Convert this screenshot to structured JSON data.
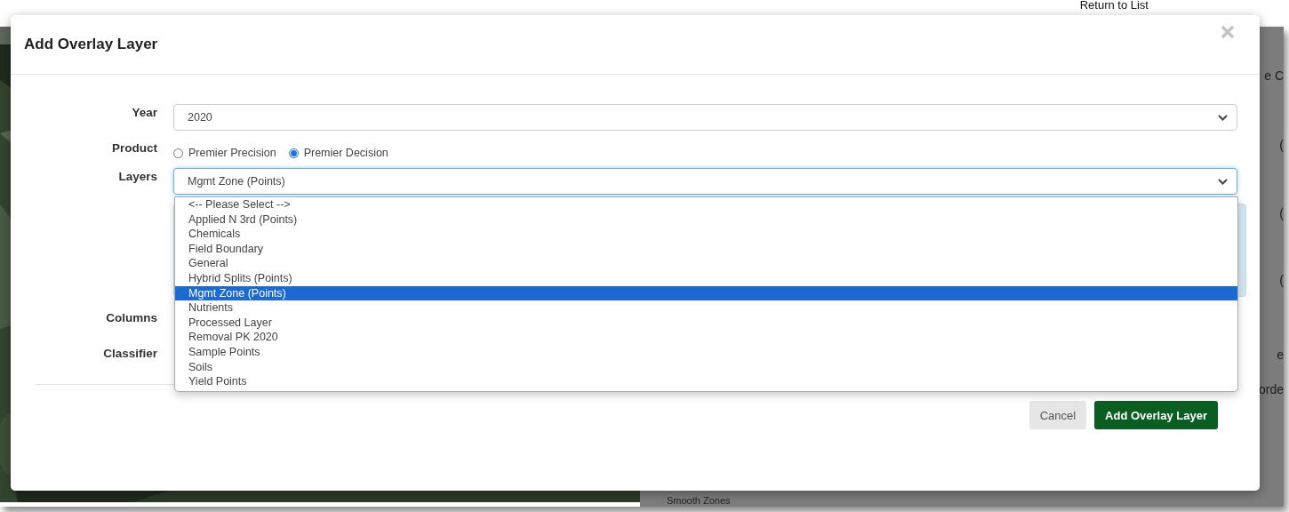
{
  "background": {
    "link": "Return to List",
    "fragments": [
      {
        "text": "e C"
      },
      {
        "text": "("
      },
      {
        "text": "("
      },
      {
        "text": "("
      },
      {
        "text": "e"
      },
      {
        "text": "orde"
      }
    ],
    "footer_text": "Smooth Zones"
  },
  "dialog": {
    "title": "Add Overlay Layer"
  },
  "fields": [
    {
      "kind": "select",
      "label": "Year",
      "value": "2020",
      "expanded": false
    },
    {
      "kind": "radio",
      "label": "Product",
      "options": [
        {
          "label": "Premier Precision",
          "selected": false
        },
        {
          "label": "Premier Decision",
          "selected": true
        }
      ]
    },
    {
      "kind": "select",
      "label": "Layers",
      "value": "Mgmt Zone (Points)",
      "expanded": true,
      "options": [
        {
          "label": "<-- Please Select -->",
          "selected": false
        },
        {
          "label": "Applied N 3rd (Points)",
          "selected": false
        },
        {
          "label": "Chemicals",
          "selected": false
        },
        {
          "label": "Field Boundary",
          "selected": false
        },
        {
          "label": "General",
          "selected": false
        },
        {
          "label": "Hybrid Splits (Points)",
          "selected": false
        },
        {
          "label": "Mgmt Zone (Points)",
          "selected": true
        },
        {
          "label": "Nutrients",
          "selected": false
        },
        {
          "label": "Processed Layer",
          "selected": false
        },
        {
          "label": "Removal PK 2020",
          "selected": false
        },
        {
          "label": "Sample Points",
          "selected": false
        },
        {
          "label": "Soils",
          "selected": false
        },
        {
          "label": "Yield Points",
          "selected": false
        }
      ]
    },
    {
      "kind": "covered",
      "label": "Columns"
    },
    {
      "kind": "covered",
      "label": "Classifier"
    }
  ],
  "buttons": [
    {
      "label": "Cancel",
      "kind": "secondary"
    },
    {
      "label": "Add Overlay Layer",
      "kind": "primary"
    }
  ]
}
